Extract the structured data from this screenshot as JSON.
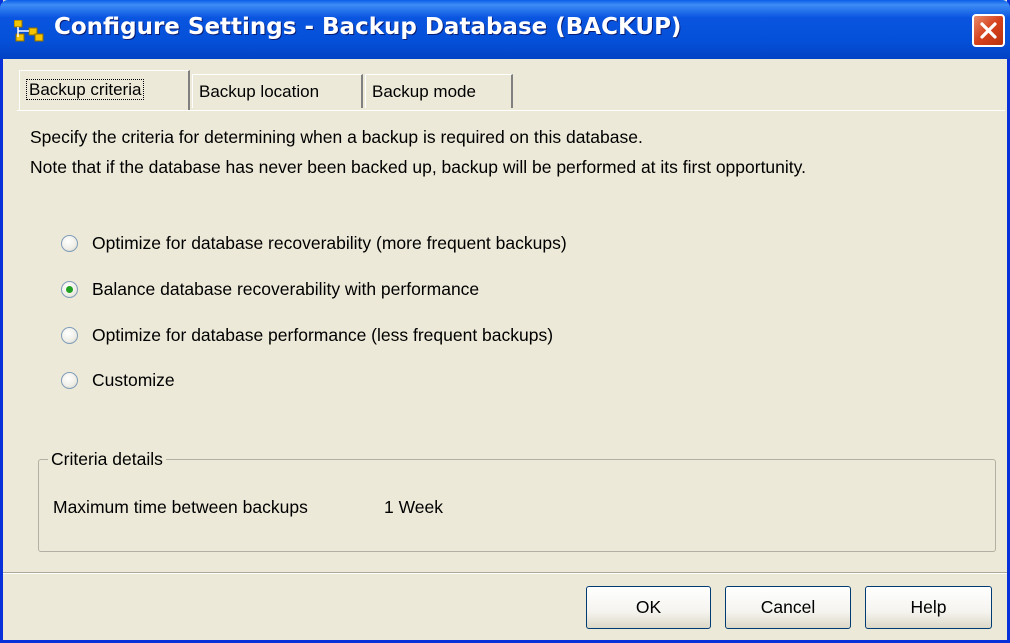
{
  "window": {
    "title": "Configure Settings - Backup Database (BACKUP)"
  },
  "tabs": [
    {
      "label": "Backup criteria",
      "active": true
    },
    {
      "label": "Backup location",
      "active": false
    },
    {
      "label": "Backup mode",
      "active": false
    }
  ],
  "description": {
    "line1": "Specify the criteria for determining when a backup is required on this database.",
    "line2": "Note that if the database has never been backed up, backup will be performed at its first opportunity."
  },
  "options": [
    {
      "label": "Optimize for database recoverability (more frequent backups)",
      "mnemonic": "O",
      "selected": false
    },
    {
      "label": "Balance database recoverability with performance",
      "mnemonic": "B",
      "selected": true
    },
    {
      "label": "Optimize for database performance (less frequent backups)",
      "mnemonic": "p",
      "selected": false
    },
    {
      "label": "Customize",
      "mnemonic": "C",
      "selected": false
    }
  ],
  "criteria_details": {
    "group_title": "Criteria details",
    "label": "Maximum time between backups",
    "value": "1 Week"
  },
  "buttons": {
    "ok": "OK",
    "cancel": "Cancel",
    "help": "Help"
  },
  "colors": {
    "titlebar": "#0550d8",
    "window_border": "#0831d9",
    "dialog_bg": "#ece9d8",
    "radio_selected": "#21a121",
    "close_button": "#d6411c"
  },
  "icons": {
    "app": "database-tree-icon",
    "close": "close-icon"
  }
}
